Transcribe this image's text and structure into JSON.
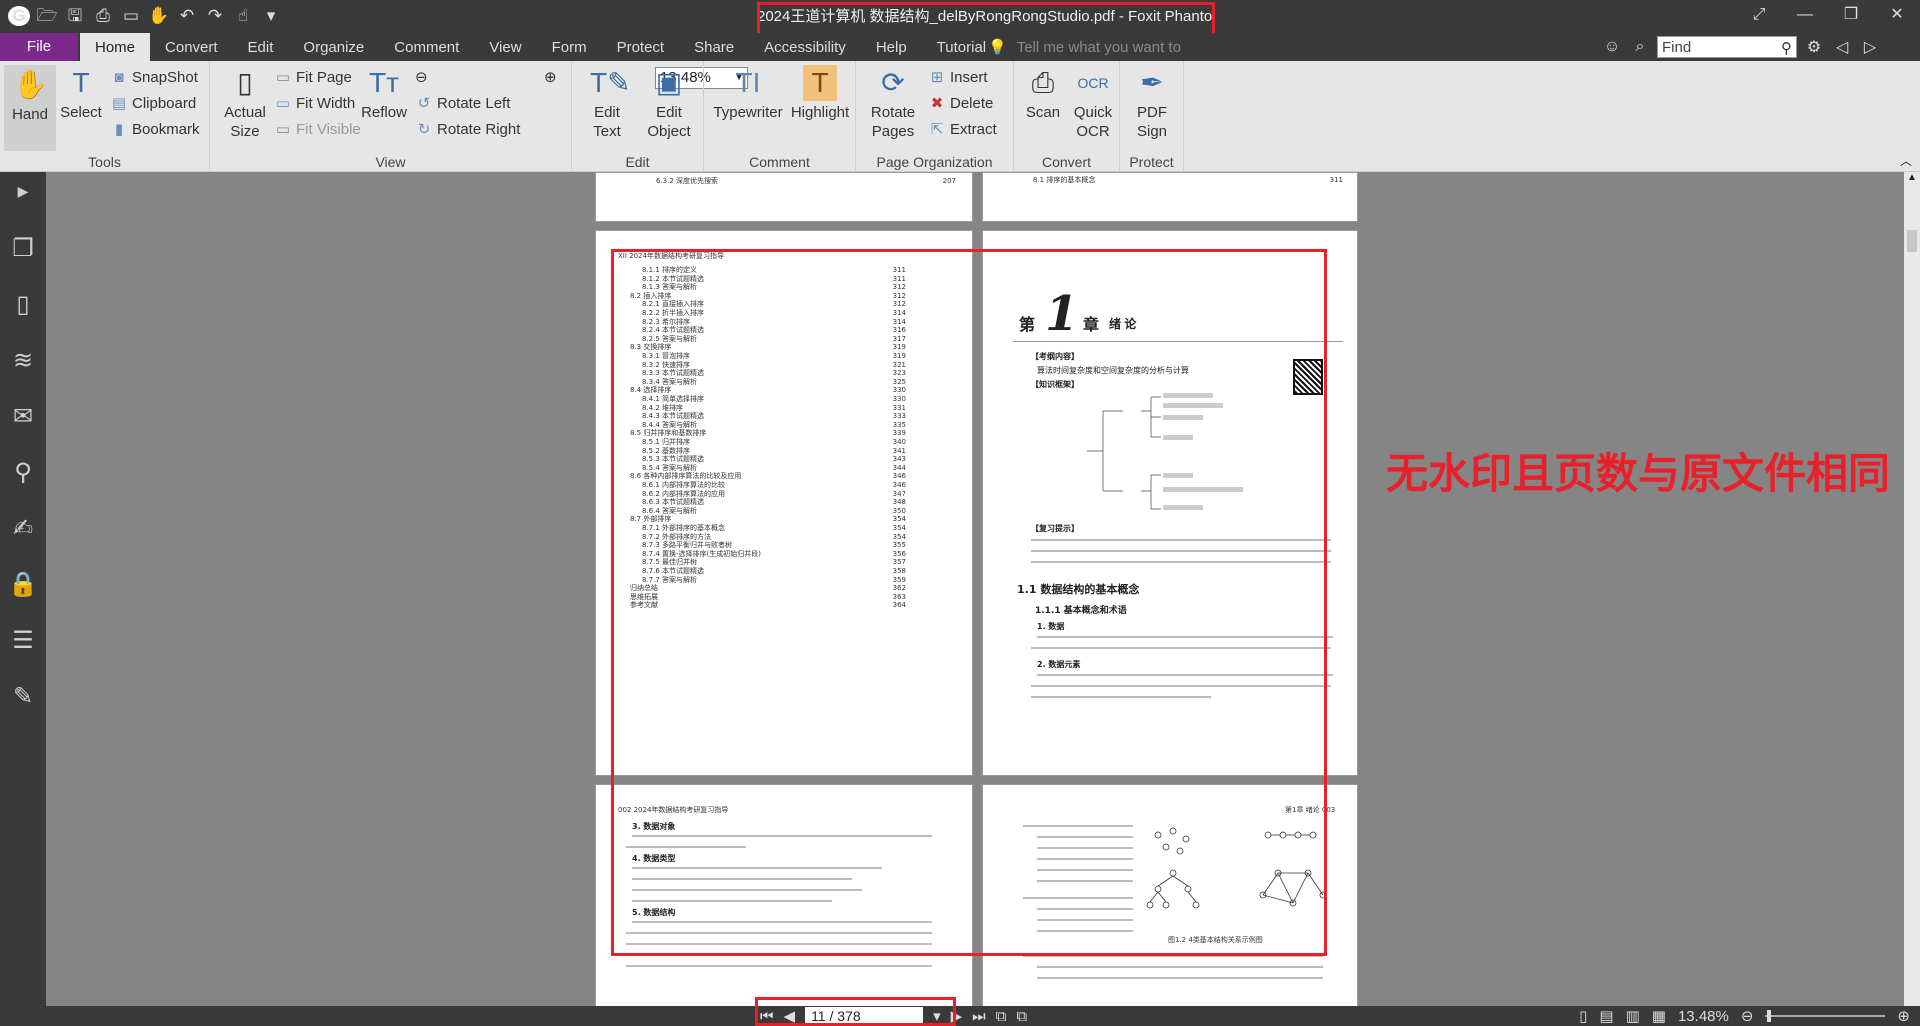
{
  "window": {
    "title": "2024王道计算机 数据结构_delByRongRongStudio.pdf - Foxit PhantomPDF",
    "controls": [
      "⤢",
      "—",
      "❐",
      "✕"
    ]
  },
  "menu": {
    "file": "File",
    "tabs": [
      "Home",
      "Convert",
      "Edit",
      "Organize",
      "Comment",
      "View",
      "Form",
      "Protect",
      "Share",
      "Accessibility",
      "Help",
      "Tutorial"
    ],
    "tell_me": "Tell me what you want to",
    "find_placeholder": "Find"
  },
  "ribbon": {
    "tools": {
      "label": "Tools",
      "hand": "Hand",
      "select": "Select",
      "snapshot": "SnapShot",
      "clipboard": "Clipboard",
      "bookmark": "Bookmark"
    },
    "view": {
      "label": "View",
      "actual_size": "Actual Size",
      "fit_page": "Fit Page",
      "fit_width": "Fit Width",
      "fit_visible": "Fit Visible",
      "reflow": "Reflow",
      "zoom": "13.48%",
      "rotate_left": "Rotate Left",
      "rotate_right": "Rotate Right"
    },
    "edit": {
      "label": "Edit",
      "edit_text": "Edit Text",
      "edit_object": "Edit Object"
    },
    "comment": {
      "label": "Comment",
      "typewriter": "Typewriter",
      "highlight": "Highlight"
    },
    "page_org": {
      "label": "Page Organization",
      "rotate_pages": "Rotate Pages",
      "insert": "Insert",
      "delete": "Delete",
      "extract": "Extract"
    },
    "convert": {
      "label": "Convert",
      "scan": "Scan",
      "quick_ocr": "Quick OCR"
    },
    "protect": {
      "label": "Protect",
      "pdf_sign": "PDF Sign"
    }
  },
  "pages": {
    "top_left_line": {
      "text": "6.3.2 深度优先搜索",
      "page": "207"
    },
    "top_right_line": {
      "text": "8.1 排序的基本概念",
      "page": "311"
    },
    "toc_header": "XII 2024年数据结构考研复习指导",
    "toc": [
      [
        "8.1.1 排序的定义",
        "311"
      ],
      [
        "8.1.2 本节试题精选",
        "311"
      ],
      [
        "8.1.3 答案与解析",
        "312"
      ],
      [
        "8.2 插入排序",
        "312"
      ],
      [
        "8.2.1 直接插入排序",
        "312"
      ],
      [
        "8.2.2 折半插入排序",
        "314"
      ],
      [
        "8.2.3 希尔排序",
        "314"
      ],
      [
        "8.2.4 本节试题精选",
        "316"
      ],
      [
        "8.2.5 答案与解析",
        "317"
      ],
      [
        "8.3 交换排序",
        "319"
      ],
      [
        "8.3.1 冒泡排序",
        "319"
      ],
      [
        "8.3.2 快速排序",
        "321"
      ],
      [
        "8.3.3 本节试题精选",
        "323"
      ],
      [
        "8.3.4 答案与解析",
        "325"
      ],
      [
        "8.4 选择排序",
        "330"
      ],
      [
        "8.4.1 简单选择排序",
        "330"
      ],
      [
        "8.4.2 堆排序",
        "331"
      ],
      [
        "8.4.3 本节试题精选",
        "333"
      ],
      [
        "8.4.4 答案与解析",
        "335"
      ],
      [
        "8.5 归并排序和基数排序",
        "339"
      ],
      [
        "8.5.1 归并排序",
        "340"
      ],
      [
        "8.5.2 基数排序",
        "341"
      ],
      [
        "8.5.3 本节试题精选",
        "343"
      ],
      [
        "8.5.4 答案与解析",
        "344"
      ],
      [
        "8.6 各种内部排序算法的比较及应用",
        "346"
      ],
      [
        "8.6.1 内部排序算法的比较",
        "346"
      ],
      [
        "8.6.2 内部排序算法的应用",
        "347"
      ],
      [
        "8.6.3 本节试题精选",
        "348"
      ],
      [
        "8.6.4 答案与解析",
        "350"
      ],
      [
        "8.7 外部排序",
        "354"
      ],
      [
        "8.7.1 外部排序的基本概念",
        "354"
      ],
      [
        "8.7.2 外部排序的方法",
        "354"
      ],
      [
        "8.7.3 多路平衡归并与败者树",
        "355"
      ],
      [
        "8.7.4 置换-选择排序(生成初始归并段)",
        "356"
      ],
      [
        "8.7.5 最佳归并树",
        "357"
      ],
      [
        "8.7.6 本节试题精选",
        "358"
      ],
      [
        "8.7.7 答案与解析",
        "359"
      ],
      [
        "归纳总结",
        "362"
      ],
      [
        "思维拓展",
        "363"
      ],
      [
        "参考文献",
        "364"
      ]
    ],
    "chapter": {
      "num": "1",
      "di": "第",
      "zhang": "章",
      "name": "绪 论",
      "kgnr": "【考纲内容】",
      "kgnr_text": "算法时间复杂度和空间复杂度的分析与计算",
      "zskj": "【知识框架】",
      "fxts": "【复习提示】",
      "s11": "1.1 数据结构的基本概念",
      "s111": "1.1.1 基本概念和术语",
      "p_data": "1. 数据",
      "p_elem": "2. 数据元素"
    },
    "next_left": {
      "header": "002 2024年数据结构考研复习指导",
      "h3": "3. 数据对象",
      "h4": "4. 数据类型",
      "h5": "5. 数据结构"
    },
    "next_right": {
      "header": "第1章 绪论 003",
      "fig": "图1.2 4类基本结构关系示例图"
    }
  },
  "overlay": {
    "note": "无水印且页数与原文件相同"
  },
  "status": {
    "page": "11 / 378",
    "zoom": "13.48%"
  }
}
